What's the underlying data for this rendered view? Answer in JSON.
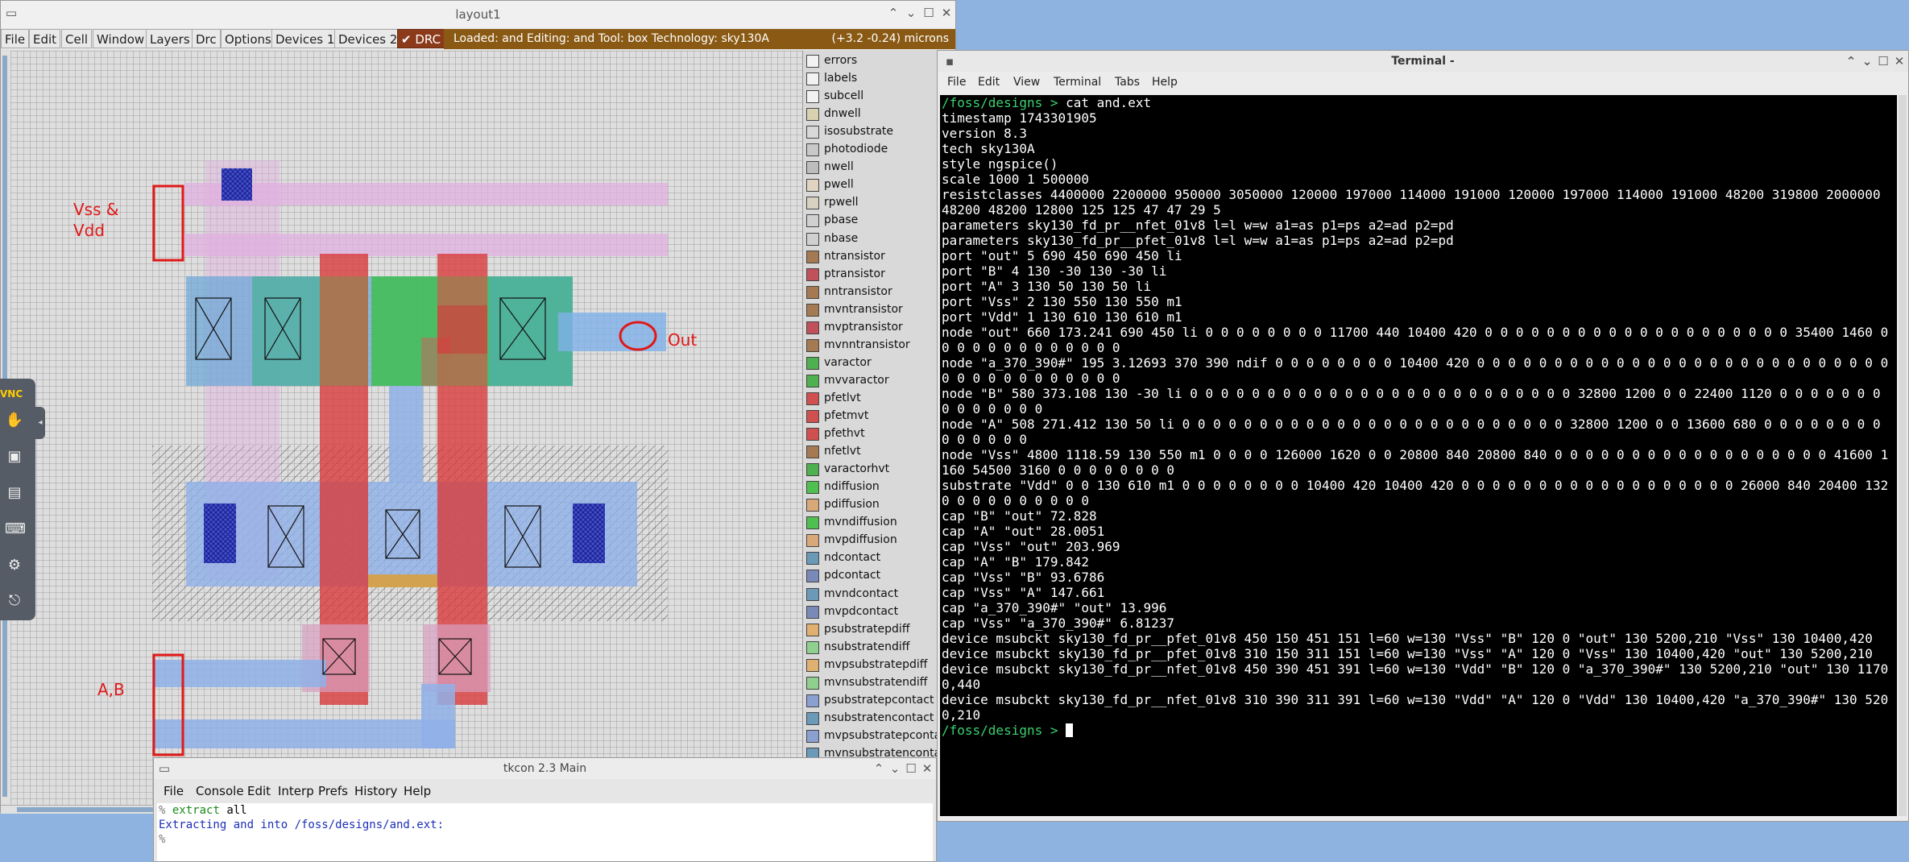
{
  "layout_window": {
    "title": "layout1",
    "menu": [
      "File",
      "Edit",
      "Cell",
      "Window",
      "Layers",
      "Drc",
      "Options",
      "Devices 1",
      "Devices 2"
    ],
    "drc_label": "DRC",
    "status": "Loaded: and  Editing: and  Tool: box   Technology: sky130A",
    "coords": "(+3.2 -0.24) microns",
    "annotations": {
      "vss_vdd_line1": "Vss &",
      "vss_vdd_line2": "Vdd",
      "out": "Out",
      "ab": "A,B"
    },
    "vnc_label": "VNC",
    "layers": [
      {
        "name": "errors",
        "color": "#f2f2f2"
      },
      {
        "name": "labels",
        "color": "#f2f2f2"
      },
      {
        "name": "subcell",
        "color": "#f2f2f2"
      },
      {
        "name": "dnwell",
        "color": "#d8d2b0"
      },
      {
        "name": "isosubstrate",
        "color": "#d8d8d8"
      },
      {
        "name": "photodiode",
        "color": "#c8c8c8"
      },
      {
        "name": "nwell",
        "color": "#bdbdbd"
      },
      {
        "name": "pwell",
        "color": "#e0d4c0"
      },
      {
        "name": "rpwell",
        "color": "#d8d0c0"
      },
      {
        "name": "pbase",
        "color": "#d0d0d0"
      },
      {
        "name": "nbase",
        "color": "#d0d0d0"
      },
      {
        "name": "ntransistor",
        "color": "#a57a52"
      },
      {
        "name": "ptransistor",
        "color": "#c0505a"
      },
      {
        "name": "nntransistor",
        "color": "#a57a52"
      },
      {
        "name": "mvntransistor",
        "color": "#a57a52"
      },
      {
        "name": "mvptransistor",
        "color": "#c0505a"
      },
      {
        "name": "mvnntransistor",
        "color": "#a57a52"
      },
      {
        "name": "varactor",
        "color": "#4fb04f"
      },
      {
        "name": "mvvaractor",
        "color": "#4fb04f"
      },
      {
        "name": "pfetlvt",
        "color": "#d05050"
      },
      {
        "name": "pfetmvt",
        "color": "#d05050"
      },
      {
        "name": "pfethvt",
        "color": "#d05050"
      },
      {
        "name": "nfetlvt",
        "color": "#a57a52"
      },
      {
        "name": "varactorhvt",
        "color": "#4fb04f"
      },
      {
        "name": "ndiffusion",
        "color": "#4fc04f"
      },
      {
        "name": "pdiffusion",
        "color": "#d8a878"
      },
      {
        "name": "mvndiffusion",
        "color": "#4fc04f"
      },
      {
        "name": "mvpdiffusion",
        "color": "#d8a878"
      },
      {
        "name": "ndcontact",
        "color": "#6a9ab8"
      },
      {
        "name": "pdcontact",
        "color": "#7a8ab8"
      },
      {
        "name": "mvndcontact",
        "color": "#6a9ab8"
      },
      {
        "name": "mvpdcontact",
        "color": "#7a8ab8"
      },
      {
        "name": "psubstratepdiff",
        "color": "#e0b070"
      },
      {
        "name": "nsubstratendiff",
        "color": "#8fd08f"
      },
      {
        "name": "mvpsubstratepdiff",
        "color": "#e0b070"
      },
      {
        "name": "mvnsubstratendiff",
        "color": "#8fd08f"
      },
      {
        "name": "psubstratepcontact",
        "color": "#8aa0d0"
      },
      {
        "name": "nsubstratencontact",
        "color": "#6a9ab8"
      },
      {
        "name": "mvpsubstratepcontact",
        "color": "#8aa0d0"
      },
      {
        "name": "mvnsubstratencontact",
        "color": "#6a9ab8"
      }
    ]
  },
  "terminal": {
    "title": "Terminal -",
    "menu": [
      "File",
      "Edit",
      "View",
      "Terminal",
      "Tabs",
      "Help"
    ],
    "prompt": "/foss/designs > ",
    "command": "cat and.ext",
    "output": [
      "timestamp 1743301905",
      "version 8.3",
      "tech sky130A",
      "style ngspice()",
      "scale 1000 1 500000",
      "resistclasses 4400000 2200000 950000 3050000 120000 197000 114000 191000 120000 197000 114000 191000 48200 319800 2000000 48200 48200 12800 125 125 47 47 29 5",
      "parameters sky130_fd_pr__nfet_01v8 l=l w=w a1=as p1=ps a2=ad p2=pd",
      "parameters sky130_fd_pr__pfet_01v8 l=l w=w a1=as p1=ps a2=ad p2=pd",
      "port \"out\" 5 690 450 690 450 li",
      "port \"B\" 4 130 -30 130 -30 li",
      "port \"A\" 3 130 50 130 50 li",
      "port \"Vss\" 2 130 550 130 550 m1",
      "port \"Vdd\" 1 130 610 130 610 m1",
      "node \"out\" 660 173.241 690 450 li 0 0 0 0 0 0 0 0 11700 440 10400 420 0 0 0 0 0 0 0 0 0 0 0 0 0 0 0 0 0 0 0 0 35400 1460 0 0 0 0 0 0 0 0 0 0 0 0 0",
      "node \"a_370_390#\" 195 3.12693 370 390 ndif 0 0 0 0 0 0 0 0 10400 420 0 0 0 0 0 0 0 0 0 0 0 0 0 0 0 0 0 0 0 0 0 0 0 0 0 0 0 0 0 0 0 0 0 0 0 0 0 0 0",
      "node \"B\" 580 373.108 130 -30 li 0 0 0 0 0 0 0 0 0 0 0 0 0 0 0 0 0 0 0 0 0 0 0 0 0 32800 1200 0 0 22400 1120 0 0 0 0 0 0 0 0 0 0 0 0 0 0",
      "node \"A\" 508 271.412 130 50 li 0 0 0 0 0 0 0 0 0 0 0 0 0 0 0 0 0 0 0 0 0 0 0 0 0 32800 1200 0 0 13600 680 0 0 0 0 0 0 0 0 0 0 0 0 0 0",
      "node \"Vss\" 4800 1118.59 130 550 m1 0 0 0 0 126000 1620 0 0 20800 840 20800 840 0 0 0 0 0 0 0 0 0 0 0 0 0 0 0 0 0 0 41600 1160 54500 3160 0 0 0 0 0 0 0 0",
      "substrate \"Vdd\" 0 0 130 610 m1 0 0 0 0 0 0 0 0 10400 420 10400 420 0 0 0 0 0 0 0 0 0 0 0 0 0 0 0 0 0 0 26000 840 20400 1320 0 0 0 0 0 0 0 0 0",
      "cap \"B\" \"out\" 72.828",
      "cap \"A\" \"out\" 28.0051",
      "cap \"Vss\" \"out\" 203.969",
      "cap \"A\" \"B\" 179.842",
      "cap \"Vss\" \"B\" 93.6786",
      "cap \"Vss\" \"A\" 147.661",
      "cap \"a_370_390#\" \"out\" 13.996",
      "cap \"Vss\" \"a_370_390#\" 6.81237",
      "device msubckt sky130_fd_pr__pfet_01v8 450 150 451 151 l=60 w=130 \"Vss\" \"B\" 120 0 \"out\" 130 5200,210 \"Vss\" 130 10400,420",
      "device msubckt sky130_fd_pr__pfet_01v8 310 150 311 151 l=60 w=130 \"Vss\" \"A\" 120 0 \"Vss\" 130 10400,420 \"out\" 130 5200,210",
      "device msubckt sky130_fd_pr__nfet_01v8 450 390 451 391 l=60 w=130 \"Vdd\" \"B\" 120 0 \"a_370_390#\" 130 5200,210 \"out\" 130 11700,440",
      "device msubckt sky130_fd_pr__nfet_01v8 310 390 311 391 l=60 w=130 \"Vdd\" \"A\" 120 0 \"Vdd\" 130 10400,420 \"a_370_390#\" 130 5200,210"
    ]
  },
  "tkcon": {
    "title": "tkcon 2.3 Main",
    "menu": [
      "File",
      "Console",
      "Edit",
      "Interp",
      "Prefs",
      "History",
      "Help"
    ],
    "prompt_symbol": "%",
    "command_word": "extract",
    "command_arg": "all",
    "output": "Extracting and into /foss/designs/and.ext:"
  }
}
